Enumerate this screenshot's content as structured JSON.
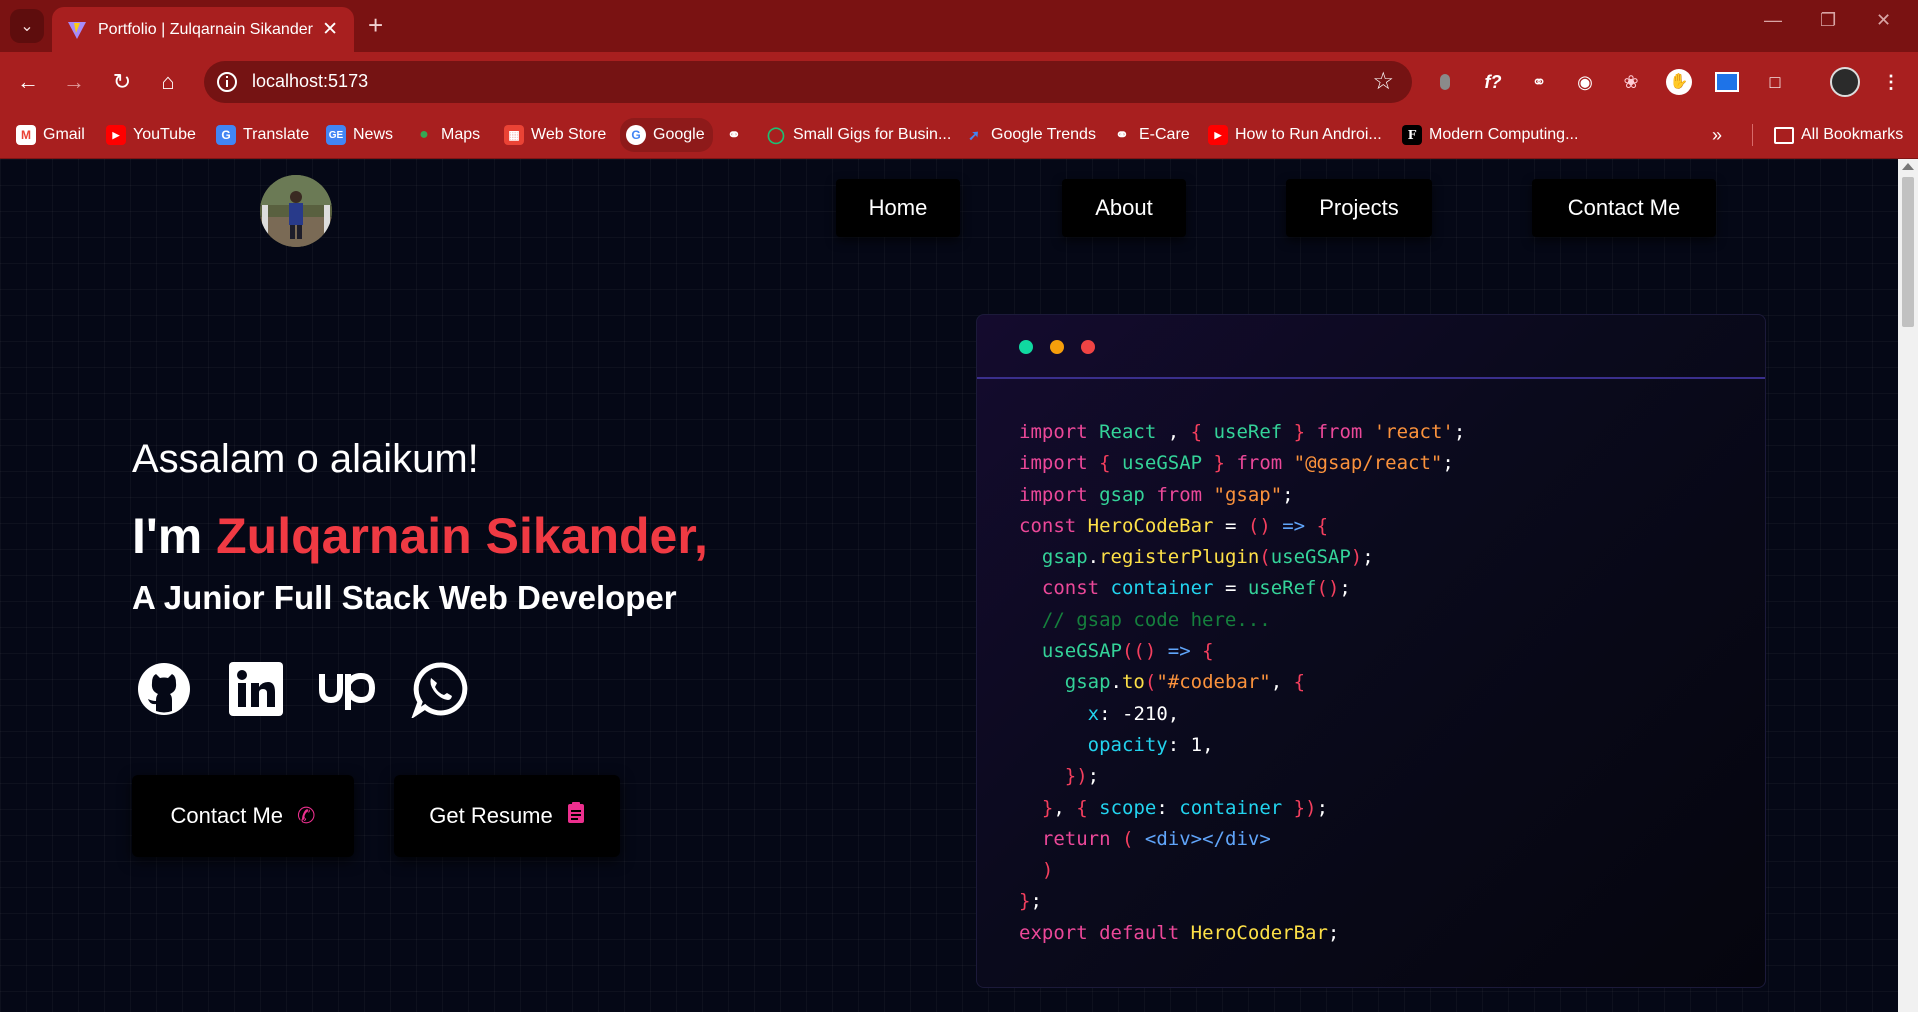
{
  "browser": {
    "tab_title": "Portfolio | Zulqarnain Sikander",
    "url": "localhost:5173",
    "theme_color": "#a81f1f",
    "bookmarks": [
      {
        "label": "Gmail",
        "icon": "gmail-icon"
      },
      {
        "label": "YouTube",
        "icon": "youtube-icon"
      },
      {
        "label": "Translate",
        "icon": "translate-icon"
      },
      {
        "label": "News",
        "icon": "news-icon"
      },
      {
        "label": "Maps",
        "icon": "maps-icon"
      },
      {
        "label": "Web Store",
        "icon": "webstore-icon"
      },
      {
        "label": "Google",
        "icon": "google-icon"
      },
      {
        "label": "",
        "icon": "globe-icon"
      },
      {
        "label": "Small Gigs for Busin...",
        "icon": "fiverr-icon"
      },
      {
        "label": "Google Trends",
        "icon": "trends-icon"
      },
      {
        "label": "E-Care",
        "icon": "globe-icon"
      },
      {
        "label": "How to Run Androi...",
        "icon": "youtube-icon"
      },
      {
        "label": "Modern Computing...",
        "icon": "f-icon"
      }
    ],
    "all_bookmarks": "All Bookmarks"
  },
  "nav": {
    "home": "Home",
    "about": "About",
    "projects": "Projects",
    "contact": "Contact Me"
  },
  "hero": {
    "greeting": "Assalam o alaikum!",
    "im": "I'm ",
    "name": "Zulqarnain Sikander,",
    "role": "A Junior Full Stack Web Developer",
    "name_color": "#f03a43",
    "contact_button": "Contact Me",
    "resume_button": "Get Resume",
    "socials": [
      "github-icon",
      "linkedin-icon",
      "upwork-icon",
      "whatsapp-icon"
    ]
  },
  "code_window": {
    "dots": [
      "#10d9a0",
      "#f59e0b",
      "#ef4444"
    ],
    "lines": [
      "import React , { useRef } from 'react';",
      "import { useGSAP } from \"@gsap/react\";",
      "import gsap from \"gsap\";",
      "const HeroCodeBar = () => {",
      "  gsap.registerPlugin(useGSAP);",
      "  const container = useRef();",
      "  // gsap code here...",
      "  useGSAP(() => {",
      "    gsap.to(\"#codebar\", {",
      "      x: -210,",
      "      opacity: 1,",
      "    });",
      "  }, { scope: container });",
      "  return ( <div></div>",
      "  )",
      "};",
      "export default HeroCoderBar;"
    ]
  }
}
